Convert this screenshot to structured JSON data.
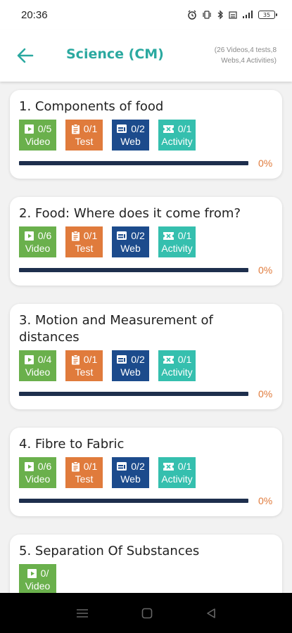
{
  "status_bar": {
    "time": "20:36",
    "battery": "35"
  },
  "header": {
    "title": "Science (CM)",
    "summary_line1": "(26 Videos,4 tests,8",
    "summary_line2": "Webs,4 Activities)"
  },
  "colors": {
    "accent": "#2ba9a0",
    "video": "#6ab04c",
    "test": "#e07b3c",
    "web": "#1c4b8c",
    "activity": "#35bfae",
    "progress_track": "#1e2f4d",
    "percent": "#e07b3c"
  },
  "chapters": [
    {
      "title": "1. Components of food",
      "video": {
        "count": "0/5",
        "label": "Video"
      },
      "test": {
        "count": "0/1",
        "label": "Test"
      },
      "web": {
        "count": "0/2",
        "label": "Web"
      },
      "activity": {
        "count": "0/1",
        "label": "Activity"
      },
      "progress": 0,
      "percent": "0%"
    },
    {
      "title": "2. Food: Where does it come from?",
      "video": {
        "count": "0/6",
        "label": "Video"
      },
      "test": {
        "count": "0/1",
        "label": "Test"
      },
      "web": {
        "count": "0/2",
        "label": "Web"
      },
      "activity": {
        "count": "0/1",
        "label": "Activity"
      },
      "progress": 0,
      "percent": "0%"
    },
    {
      "title": "3. Motion and Measurement of distances",
      "video": {
        "count": "0/4",
        "label": "Video"
      },
      "test": {
        "count": "0/1",
        "label": "Test"
      },
      "web": {
        "count": "0/2",
        "label": "Web"
      },
      "activity": {
        "count": "0/1",
        "label": "Activity"
      },
      "progress": 0,
      "percent": "0%"
    },
    {
      "title": "4. Fibre to Fabric",
      "video": {
        "count": "0/6",
        "label": "Video"
      },
      "test": {
        "count": "0/1",
        "label": "Test"
      },
      "web": {
        "count": "0/2",
        "label": "Web"
      },
      "activity": {
        "count": "0/1",
        "label": "Activity"
      },
      "progress": 0,
      "percent": "0%"
    },
    {
      "title": "5. Separation Of Substances",
      "video": {
        "count": "0/",
        "label": "Video"
      }
    }
  ],
  "icons": {
    "back": "arrow-left-icon",
    "video": "play-box-icon",
    "test": "clipboard-icon",
    "web": "browser-icon",
    "activity": "ticket-icon",
    "nav_menu": "menu-icon",
    "nav_home": "home-square-icon",
    "nav_back": "back-triangle-icon"
  }
}
